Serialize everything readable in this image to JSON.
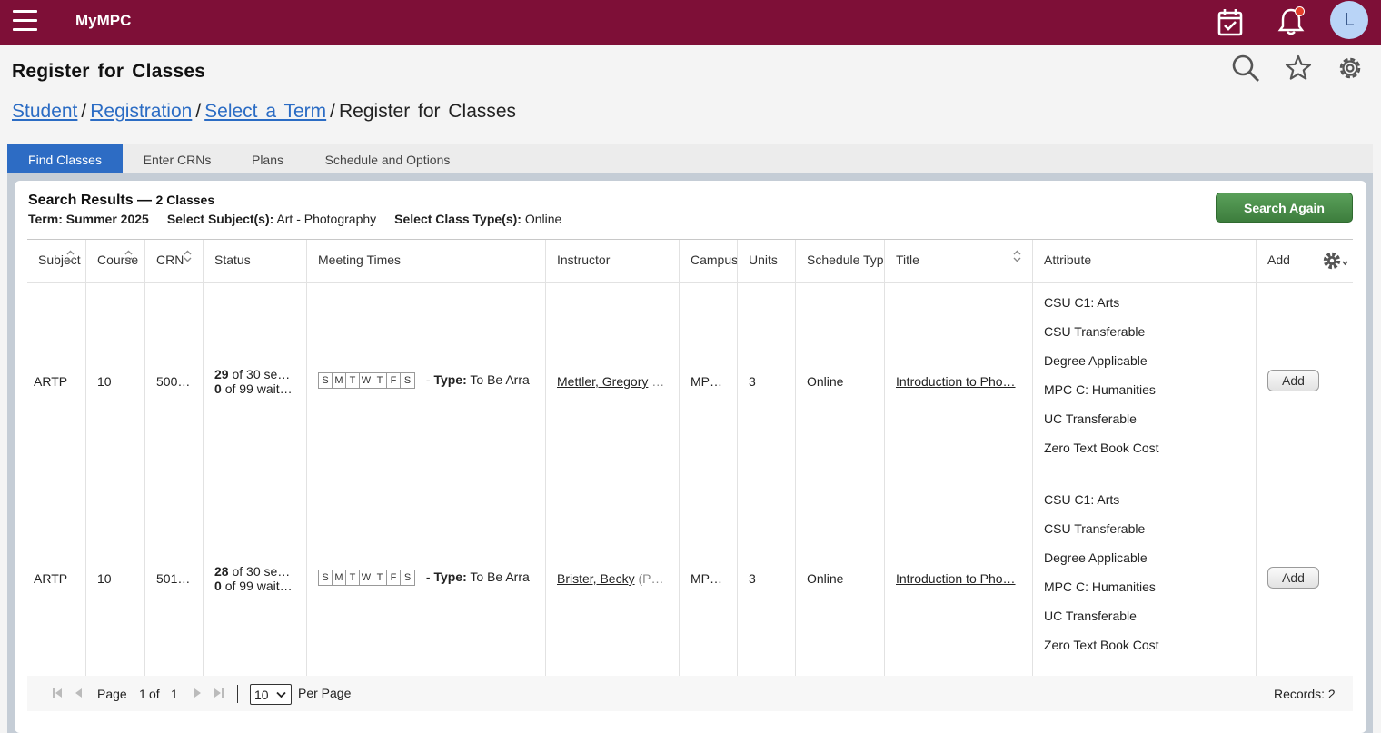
{
  "app": {
    "title": "MyMPC",
    "user_initial": "L"
  },
  "header": {
    "page_title": "Register for Classes",
    "breadcrumb": [
      {
        "label": "Student",
        "link": true
      },
      {
        "label": "Registration",
        "link": true
      },
      {
        "label": "Select a Term",
        "link": true
      },
      {
        "label": "Register for Classes",
        "link": false
      }
    ]
  },
  "tabs": [
    {
      "label": "Find Classes",
      "active": true
    },
    {
      "label": "Enter CRNs",
      "active": false
    },
    {
      "label": "Plans",
      "active": false
    },
    {
      "label": "Schedule and Options",
      "active": false
    }
  ],
  "search": {
    "title": "Search Results —",
    "count_label": "2 Classes",
    "term_label": "Term:",
    "term_value": "Summer 2025",
    "subject_label": "Select Subject(s):",
    "subject_value": "Art - Photography",
    "class_type_label": "Select Class Type(s):",
    "class_type_value": "Online",
    "search_again_label": "Search Again"
  },
  "table": {
    "columns": [
      "Subject",
      "Course",
      "CRN",
      "Status",
      "Meeting Times",
      "Instructor",
      "Campus",
      "Units",
      "Schedule Typ",
      "Title",
      "Attribute",
      "Add"
    ],
    "day_letters": [
      "S",
      "M",
      "T",
      "W",
      "T",
      "F",
      "S"
    ],
    "type_label": "Type:",
    "type_dash": "-",
    "rows": [
      {
        "subject": "ARTP",
        "course": "10",
        "crn": "500…",
        "seats_avail": "29",
        "seats_text": "of 30 se…",
        "wait_avail": "0",
        "wait_text": "of 99 wait…",
        "meeting_type": "To Be Arra",
        "instructor": "Mettler, Gregory",
        "instructor_extra": "…",
        "campus": "MP…",
        "units": "3",
        "schedule_type": "Online",
        "title": "Introduction to Pho…",
        "attributes": [
          "CSU C1: Arts",
          "CSU Transferable",
          "Degree Applicable",
          "MPC C: Humanities",
          "UC Transferable",
          "Zero Text Book Cost"
        ],
        "add_label": "Add"
      },
      {
        "subject": "ARTP",
        "course": "10",
        "crn": "501…",
        "seats_avail": "28",
        "seats_text": "of 30 se…",
        "wait_avail": "0",
        "wait_text": "of 99 wait…",
        "meeting_type": "To Be Arra",
        "instructor": "Brister, Becky",
        "instructor_extra": "(P…",
        "campus": "MP…",
        "units": "3",
        "schedule_type": "Online",
        "title": "Introduction to Pho…",
        "attributes": [
          "CSU C1: Arts",
          "CSU Transferable",
          "Degree Applicable",
          "MPC C: Humanities",
          "UC Transferable",
          "Zero Text Book Cost"
        ],
        "add_label": "Add"
      }
    ]
  },
  "pager": {
    "page_label": "Page",
    "page_current": "1",
    "of_label": "of",
    "page_total": "1",
    "per_page_value": "10",
    "per_page_label": "Per Page",
    "records_label": "Records: 2"
  },
  "colors": {
    "brand": "#7e0f37",
    "tab_active": "#2d6cc4",
    "link": "#2b6cc4",
    "search_again": "#4a8c4a"
  }
}
